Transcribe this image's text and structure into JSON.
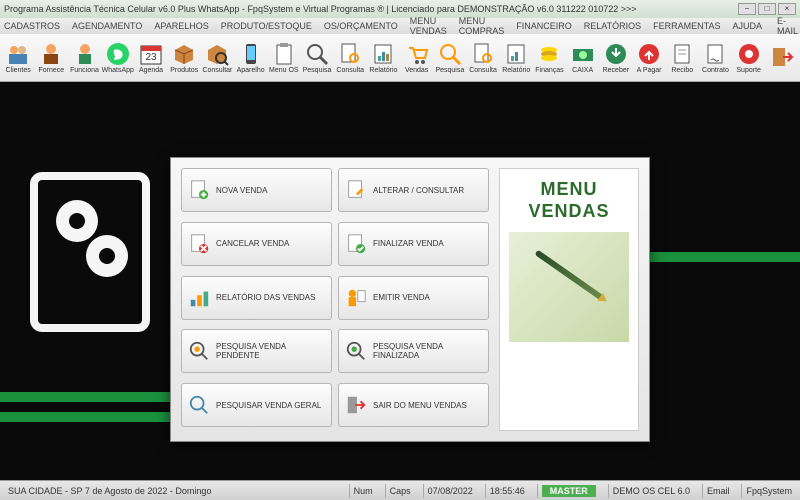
{
  "window": {
    "title": "Programa Assistência Técnica Celular v6.0 Plus WhatsApp - FpqSystem e Virtual Programas ® | Licenciado para  DEMONSTRAÇÃO v6.0 311222 010722 >>>"
  },
  "menubar": {
    "items": [
      "CADASTROS",
      "AGENDAMENTO",
      "APARELHOS",
      "PRODUTO/ESTOQUE",
      "OS/ORÇAMENTO",
      "MENU VENDAS",
      "MENU COMPRAS",
      "FINANCEIRO",
      "RELATÓRIOS",
      "FERRAMENTAS",
      "AJUDA"
    ],
    "email": "E-MAIL"
  },
  "toolbar": {
    "items": [
      {
        "label": "Clientes"
      },
      {
        "label": "Fornece"
      },
      {
        "label": "Funciona"
      },
      {
        "label": "WhatsApp"
      },
      {
        "label": "Agenda"
      },
      {
        "label": "Produtos"
      },
      {
        "label": "Consultar"
      },
      {
        "label": "Aparelho"
      },
      {
        "label": "Menu OS"
      },
      {
        "label": "Pesquisa"
      },
      {
        "label": "Consulta"
      },
      {
        "label": "Relatório"
      },
      {
        "label": "Vendas"
      },
      {
        "label": "Pesquisa"
      },
      {
        "label": "Consulta"
      },
      {
        "label": "Relatório"
      },
      {
        "label": "Finanças"
      },
      {
        "label": "CAIXA"
      },
      {
        "label": "Receber"
      },
      {
        "label": "A Pagar"
      },
      {
        "label": "Recibo"
      },
      {
        "label": "Contrato"
      },
      {
        "label": "Suporte"
      },
      {
        "label": ""
      }
    ]
  },
  "dialog": {
    "title_l1": "MENU",
    "title_l2": "VENDAS",
    "buttons": [
      {
        "label": "NOVA VENDA"
      },
      {
        "label": "ALTERAR / CONSULTAR"
      },
      {
        "label": "CANCELAR VENDA"
      },
      {
        "label": "FINALIZAR VENDA"
      },
      {
        "label": "RELATÓRIO DAS VENDAS"
      },
      {
        "label": "EMITIR VENDA"
      },
      {
        "label": "PESQUISA VENDA PENDENTE"
      },
      {
        "label": "PESQUISA VENDA FINALIZADA"
      },
      {
        "label": "PESQUISAR VENDA GERAL"
      },
      {
        "label": "SAIR DO MENU VENDAS"
      }
    ]
  },
  "statusbar": {
    "location": "SUA CIDADE - SP  7 de Agosto de 2022 - Domingo",
    "num": "Num",
    "caps": "Caps",
    "date": "07/08/2022",
    "time": "18:55:46",
    "master": "MASTER",
    "app": "DEMO OS CEL 6.0",
    "email": "Email",
    "brand": "FpqSystem"
  }
}
